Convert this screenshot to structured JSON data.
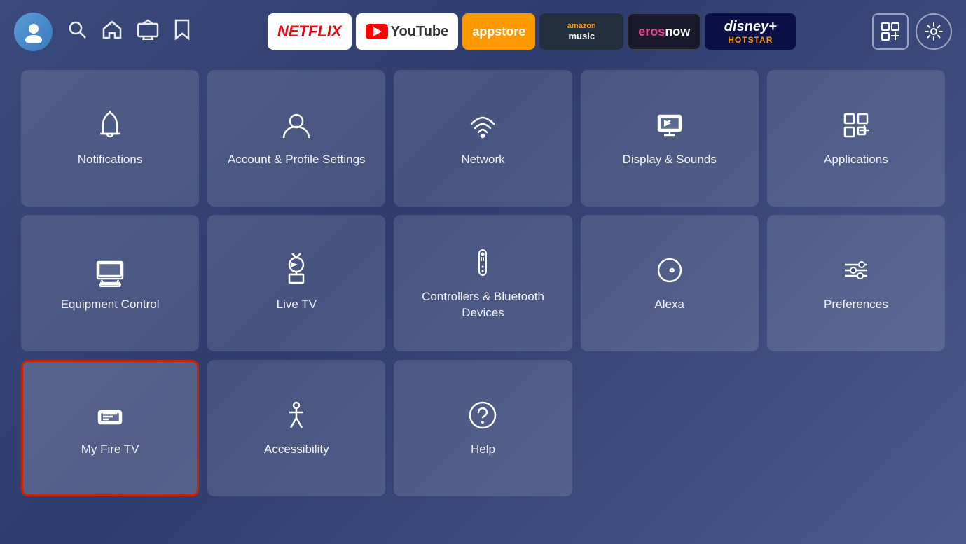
{
  "nav": {
    "apps": [
      {
        "id": "netflix",
        "label": "NETFLIX",
        "type": "netflix"
      },
      {
        "id": "youtube",
        "label": "YouTube",
        "type": "youtube"
      },
      {
        "id": "appstore",
        "label": "appstore",
        "type": "appstore"
      },
      {
        "id": "amazon-music",
        "label": "amazon music",
        "type": "amazon-music"
      },
      {
        "id": "erosnow",
        "label": "erosnow",
        "type": "erosnow"
      },
      {
        "id": "disney-hotstar",
        "label": "disney+ hotstar",
        "type": "disney"
      }
    ]
  },
  "tiles": [
    {
      "id": "notifications",
      "label": "Notifications",
      "icon": "bell"
    },
    {
      "id": "account-profile",
      "label": "Account & Profile Settings",
      "icon": "person"
    },
    {
      "id": "network",
      "label": "Network",
      "icon": "wifi"
    },
    {
      "id": "display-sounds",
      "label": "Display & Sounds",
      "icon": "display"
    },
    {
      "id": "applications",
      "label": "Applications",
      "icon": "apps"
    },
    {
      "id": "equipment-control",
      "label": "Equipment Control",
      "icon": "monitor"
    },
    {
      "id": "live-tv",
      "label": "Live TV",
      "icon": "antenna"
    },
    {
      "id": "controllers-bluetooth",
      "label": "Controllers & Bluetooth Devices",
      "icon": "remote"
    },
    {
      "id": "alexa",
      "label": "Alexa",
      "icon": "alexa"
    },
    {
      "id": "preferences",
      "label": "Preferences",
      "icon": "sliders"
    },
    {
      "id": "my-fire-tv",
      "label": "My Fire TV",
      "icon": "firetv",
      "selected": true
    },
    {
      "id": "accessibility",
      "label": "Accessibility",
      "icon": "accessibility"
    },
    {
      "id": "help",
      "label": "Help",
      "icon": "help"
    }
  ]
}
